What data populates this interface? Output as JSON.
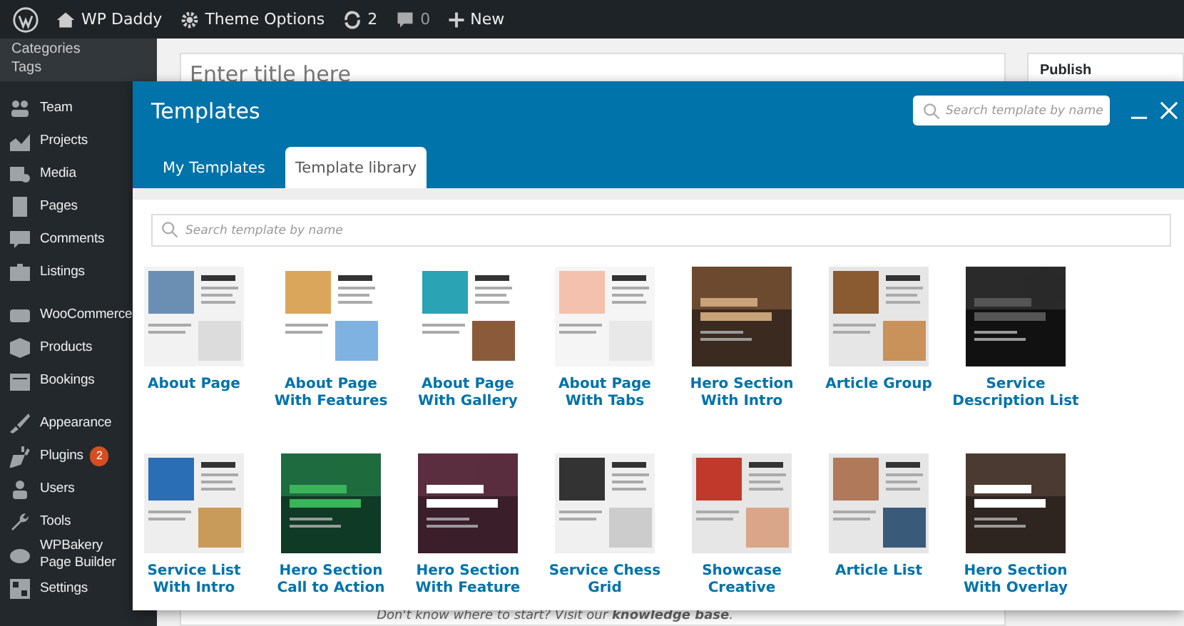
{
  "admin_bar": {
    "site": "WP Daddy",
    "theme_options": "Theme Options",
    "updates": "2",
    "comments": "0",
    "new": "New"
  },
  "sidebar": {
    "submenu": [
      "Categories",
      "Tags"
    ],
    "groups": [
      [
        {
          "label": "Team"
        },
        {
          "label": "Projects"
        },
        {
          "label": "Media"
        },
        {
          "label": "Pages"
        },
        {
          "label": "Comments"
        },
        {
          "label": "Listings"
        }
      ],
      [
        {
          "label": "WooCommerce"
        },
        {
          "label": "Products"
        },
        {
          "label": "Bookings"
        }
      ],
      [
        {
          "label": "Appearance"
        },
        {
          "label": "Plugins",
          "badge": "2"
        },
        {
          "label": "Users"
        },
        {
          "label": "Tools"
        },
        {
          "label": "WPBakery Page Builder"
        },
        {
          "label": "Settings"
        }
      ]
    ]
  },
  "editor": {
    "title_placeholder": "Enter title here",
    "publish": "Publish",
    "hint": "Don't know where to start? Visit our **knowledge base**."
  },
  "modal": {
    "title": "Templates",
    "header_search": {
      "placeholder": "Search template by name"
    },
    "tabs": [
      {
        "label": "My Templates",
        "selected": false
      },
      {
        "label": "Template library",
        "selected": true
      }
    ],
    "search": {
      "placeholder": "Search template by name"
    },
    "templates": [
      {
        "name": "About Page"
      },
      {
        "name": "About Page With Features"
      },
      {
        "name": "About Page With Gallery"
      },
      {
        "name": "About Page With Tabs"
      },
      {
        "name": "Hero Section With Intro"
      },
      {
        "name": "Article Group"
      },
      {
        "name": "Service Description List"
      },
      {
        "name": "Service List With Intro"
      },
      {
        "name": "Hero Section Call to Action"
      },
      {
        "name": "Hero Section With Feature"
      },
      {
        "name": "Service Chess Grid"
      },
      {
        "name": "Showcase Creative"
      },
      {
        "name": "Article List"
      },
      {
        "name": "Hero Section With Overlay"
      }
    ]
  }
}
